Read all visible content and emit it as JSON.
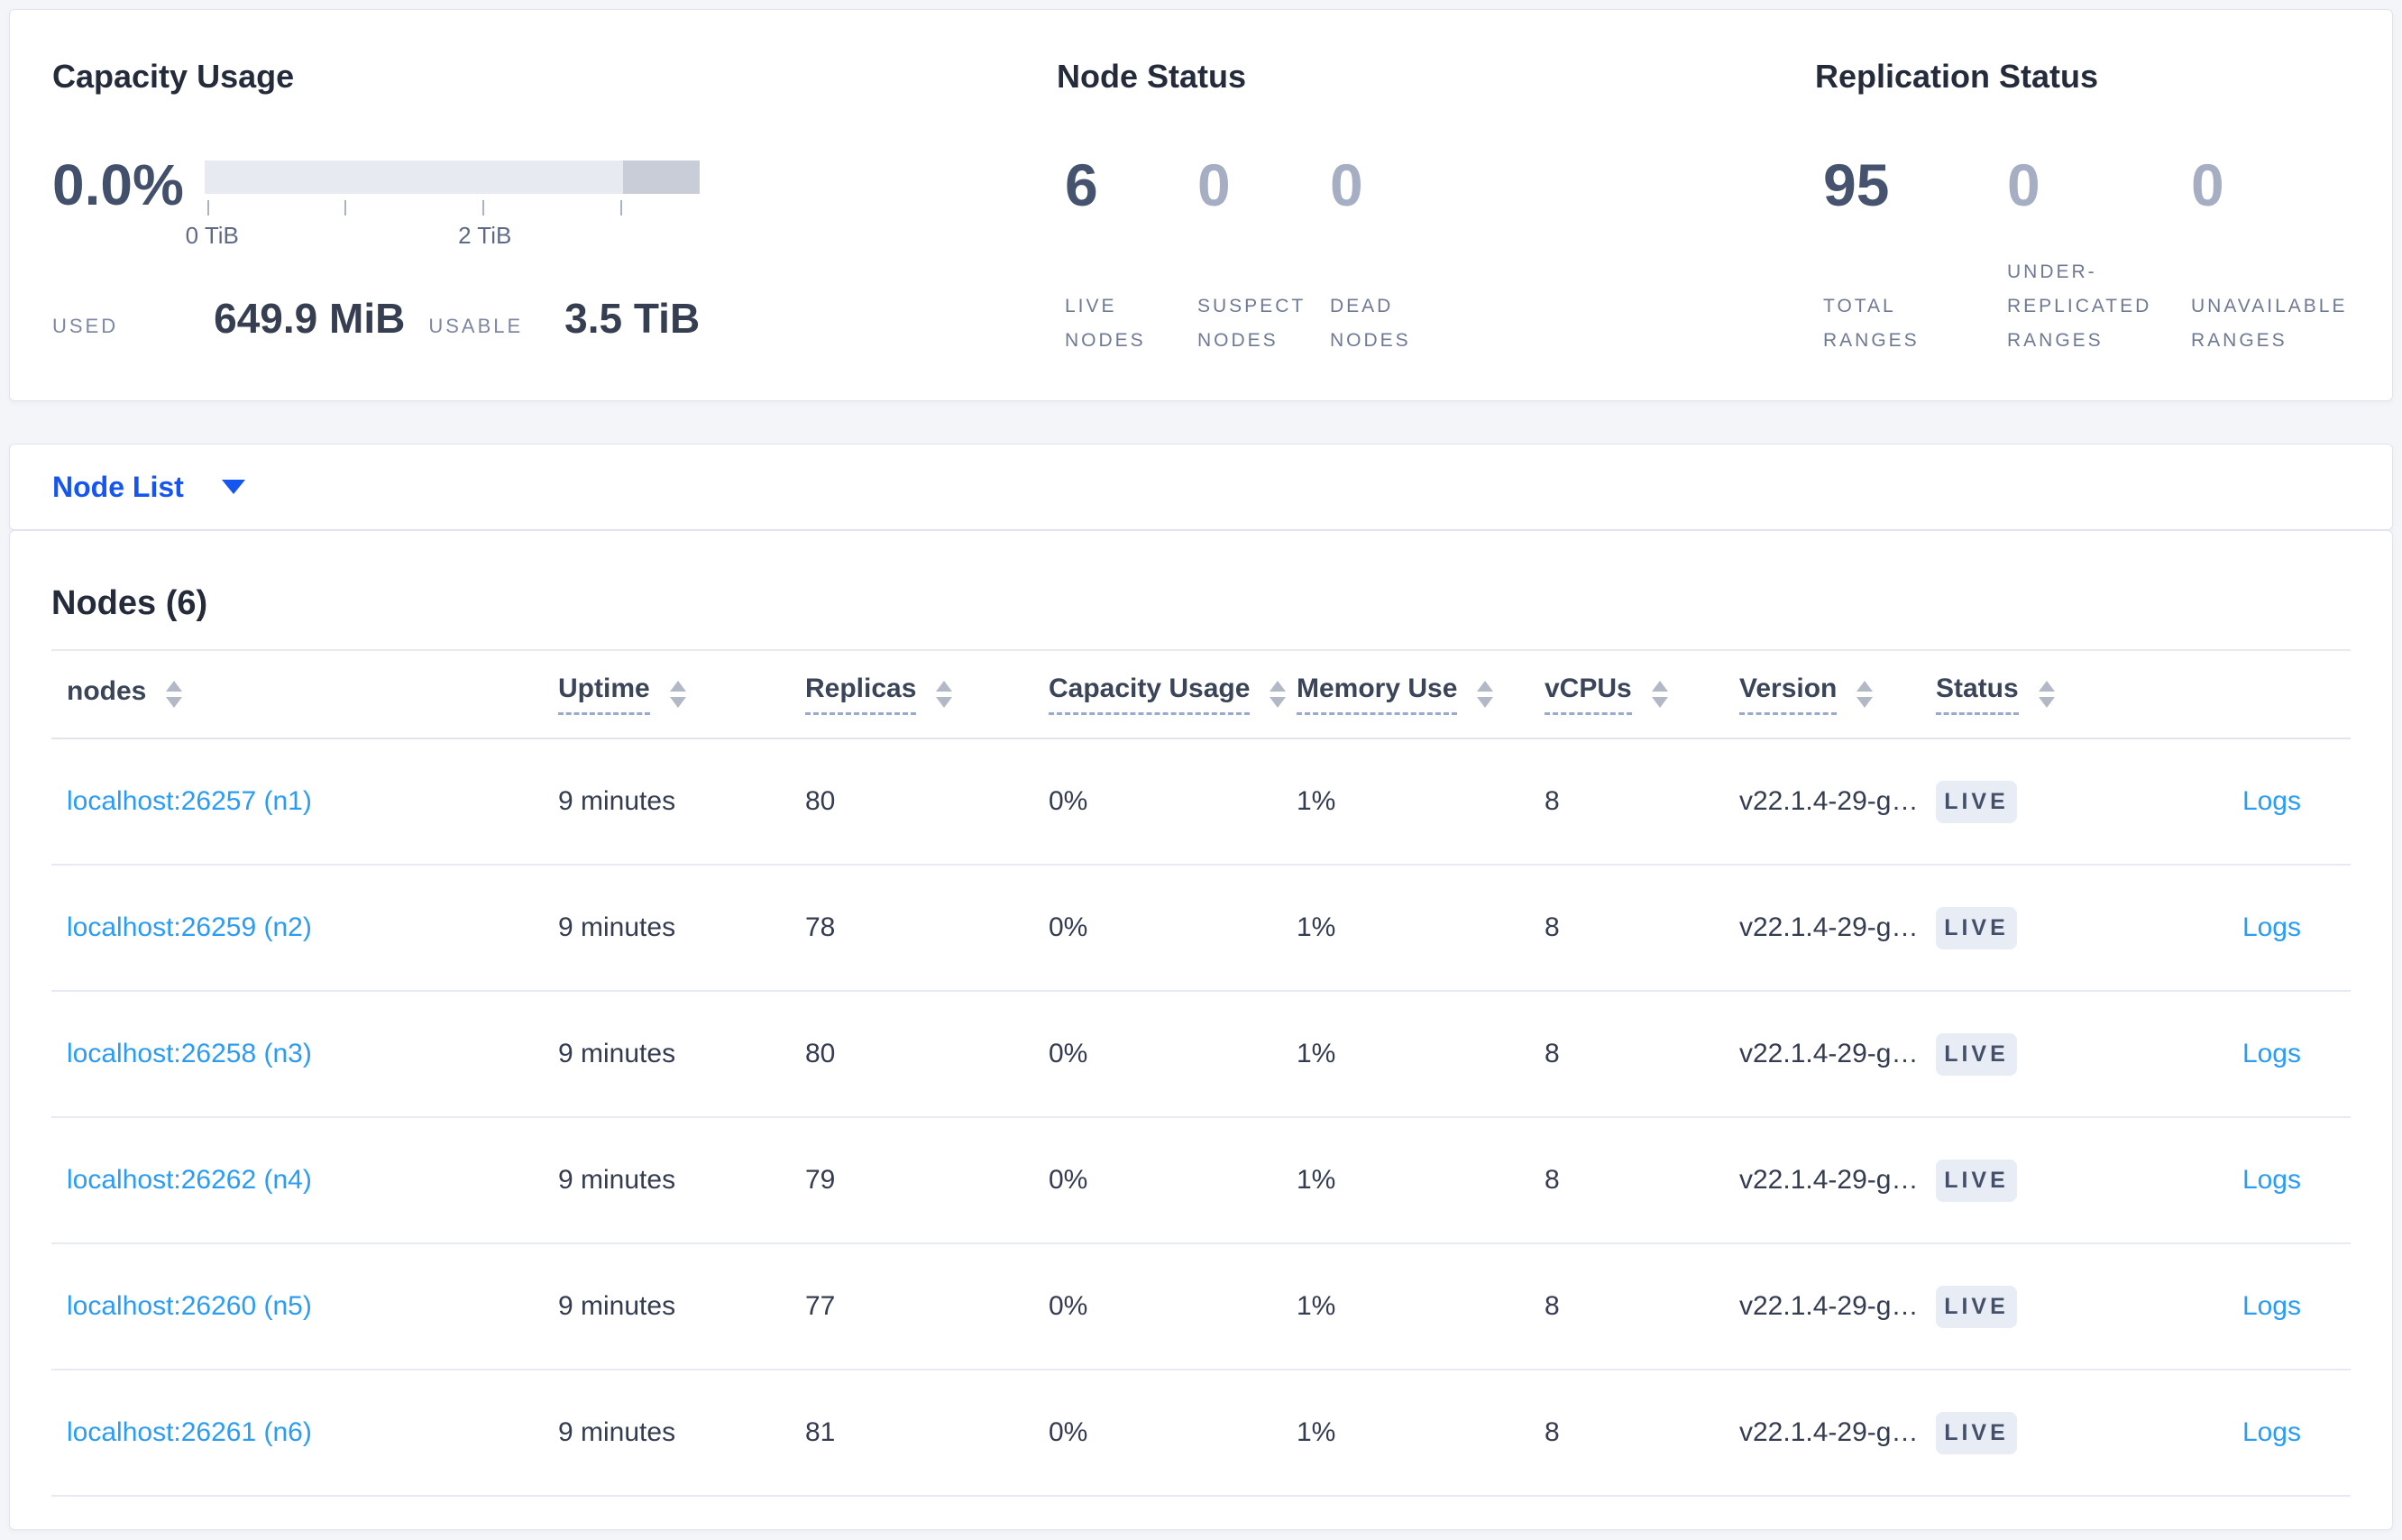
{
  "colors": {
    "page_background": "#f4f5f9",
    "accent_blue": "#1556f0",
    "link_blue": "#2b9cf4",
    "dark_number": "#46536e",
    "muted_number": "#a6aec3",
    "bar_track": "#e8eaf1",
    "bar_dark_segment": "#c9cdd8",
    "badge_background": "#e8ecf4",
    "badge_text": "#44506a"
  },
  "summary": {
    "capacity": {
      "title": "Capacity Usage",
      "percent": "0.0%",
      "bar": {
        "track_fraction": 0.845,
        "dark_fraction": 0.155,
        "tick_labels": [
          "0 TiB",
          "2 TiB"
        ]
      },
      "tick_label_0": "0 TiB",
      "tick_label_2": "2 TiB",
      "used_label": "USED",
      "used_value": "649.9 MiB",
      "usable_label": "USABLE",
      "usable_value": "3.5 TiB"
    },
    "node_status": {
      "title": "Node Status",
      "stats": [
        {
          "value": "6",
          "label": "LIVE\nNODES",
          "muted": false
        },
        {
          "value": "0",
          "label": "SUSPECT\nNODES",
          "muted": true
        },
        {
          "value": "0",
          "label": "DEAD\nNODES",
          "muted": true
        }
      ]
    },
    "replication_status": {
      "title": "Replication Status",
      "stats": [
        {
          "value": "95",
          "label": "TOTAL\nRANGES",
          "muted": false
        },
        {
          "value": "0",
          "label": "UNDER-\nREPLICATED\nRANGES",
          "muted": true
        },
        {
          "value": "0",
          "label": "UNAVAILABLE\nRANGES",
          "muted": true
        }
      ]
    }
  },
  "view_selector": {
    "label": "Node List"
  },
  "table": {
    "title": "Nodes (6)",
    "logs_label": "Logs",
    "columns": [
      {
        "label": "nodes"
      },
      {
        "label": "Uptime"
      },
      {
        "label": "Replicas"
      },
      {
        "label": "Capacity Usage"
      },
      {
        "label": "Memory Use"
      },
      {
        "label": "vCPUs"
      },
      {
        "label": "Version"
      },
      {
        "label": "Status"
      }
    ],
    "rows": [
      {
        "node": "localhost:26257 (n1)",
        "uptime": "9 minutes",
        "replicas": "80",
        "capacity": "0%",
        "memory": "1%",
        "vcpus": "8",
        "version": "v22.1.4-29-g…",
        "status": "LIVE"
      },
      {
        "node": "localhost:26259 (n2)",
        "uptime": "9 minutes",
        "replicas": "78",
        "capacity": "0%",
        "memory": "1%",
        "vcpus": "8",
        "version": "v22.1.4-29-g…",
        "status": "LIVE"
      },
      {
        "node": "localhost:26258 (n3)",
        "uptime": "9 minutes",
        "replicas": "80",
        "capacity": "0%",
        "memory": "1%",
        "vcpus": "8",
        "version": "v22.1.4-29-g…",
        "status": "LIVE"
      },
      {
        "node": "localhost:26262 (n4)",
        "uptime": "9 minutes",
        "replicas": "79",
        "capacity": "0%",
        "memory": "1%",
        "vcpus": "8",
        "version": "v22.1.4-29-g…",
        "status": "LIVE"
      },
      {
        "node": "localhost:26260 (n5)",
        "uptime": "9 minutes",
        "replicas": "77",
        "capacity": "0%",
        "memory": "1%",
        "vcpus": "8",
        "version": "v22.1.4-29-g…",
        "status": "LIVE"
      },
      {
        "node": "localhost:26261 (n6)",
        "uptime": "9 minutes",
        "replicas": "81",
        "capacity": "0%",
        "memory": "1%",
        "vcpus": "8",
        "version": "v22.1.4-29-g…",
        "status": "LIVE"
      }
    ]
  }
}
